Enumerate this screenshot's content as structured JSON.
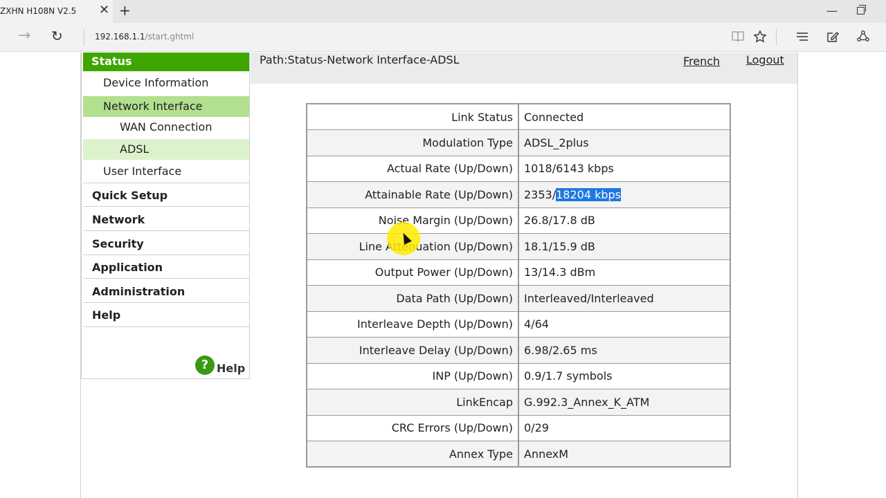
{
  "browser": {
    "tab_title": "ZXHN H108N V2.5",
    "tab_close": "✕",
    "new_tab": "+",
    "window_minimize": "—",
    "forward_glyph": "→",
    "refresh_glyph": "↻",
    "url_host": "192.168.1.1",
    "url_path": "/start.ghtml",
    "toolbar_icons": [
      "reading-view-icon",
      "favorite-star-icon",
      "hub-icon",
      "web-note-icon",
      "share-icon"
    ]
  },
  "header": {
    "path": "Path:Status-Network Interface-ADSL",
    "french_link": "French",
    "logout_link": "Logout"
  },
  "menu": {
    "status": "Status",
    "device_information": "Device Information",
    "network_interface": "Network Interface",
    "wan_connection": "WAN Connection",
    "adsl": "ADSL",
    "user_interface": "User Interface",
    "quick_setup": "Quick Setup",
    "network": "Network",
    "security": "Security",
    "application": "Application",
    "administration": "Administration",
    "help": "Help",
    "help_badge": "?",
    "help_footer": "Help"
  },
  "adsl_table": {
    "rows": [
      {
        "label": "Link Status",
        "value": "Connected"
      },
      {
        "label": "Modulation Type",
        "value": "ADSL_2plus"
      },
      {
        "label": "Actual Rate (Up/Down)",
        "value": "1018/6143 kbps"
      },
      {
        "label": "Attainable Rate (Up/Down)",
        "value_prefix": "2353/",
        "value_selected": "18204 kbps"
      },
      {
        "label": "Noise Margin (Up/Down)",
        "value": "26.8/17.8 dB"
      },
      {
        "label": "Line Attenuation (Up/Down)",
        "value": "18.1/15.9 dB"
      },
      {
        "label": "Output Power (Up/Down)",
        "value": "13/14.3 dBm"
      },
      {
        "label": "Data Path (Up/Down)",
        "value": "Interleaved/Interleaved"
      },
      {
        "label": "Interleave Depth (Up/Down)",
        "value": "4/64"
      },
      {
        "label": "Interleave Delay (Up/Down)",
        "value": "6.98/2.65 ms"
      },
      {
        "label": "INP (Up/Down)",
        "value": "0.9/1.7 symbols"
      },
      {
        "label": "LinkEncap",
        "value": "G.992.3_Annex_K_ATM"
      },
      {
        "label": "CRC Errors (Up/Down)",
        "value": "0/29"
      },
      {
        "label": "Annex Type",
        "value": "AnnexM"
      }
    ]
  },
  "colors": {
    "menu_green": "#3ea600",
    "menu_active": "#b2e08e",
    "menu_subactive": "#dcf2cc",
    "selection_blue": "#1e78e0"
  }
}
